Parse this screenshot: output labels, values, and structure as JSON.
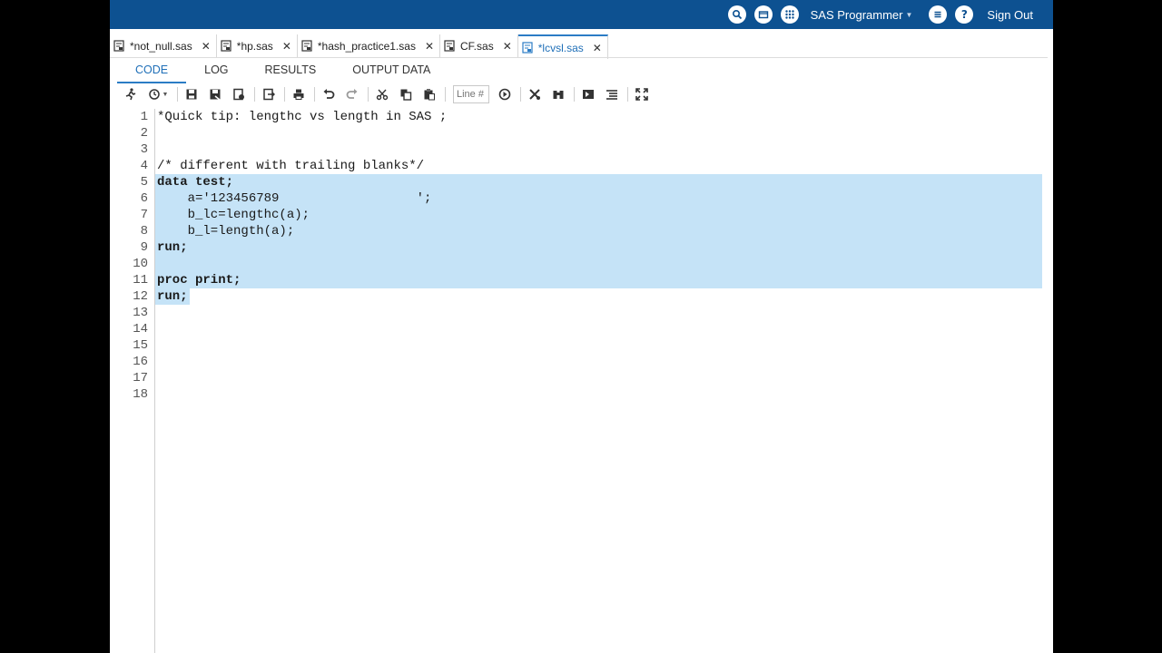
{
  "header": {
    "user": "SAS Programmer",
    "sign_out": "Sign Out",
    "icons": [
      "search-icon",
      "folder-icon",
      "apps-grid-icon",
      "menu-icon",
      "help-icon"
    ]
  },
  "file_tabs": [
    {
      "label": "*not_null.sas",
      "active": false
    },
    {
      "label": "*hp.sas",
      "active": false
    },
    {
      "label": "*hash_practice1.sas",
      "active": false
    },
    {
      "label": "CF.sas",
      "active": false
    },
    {
      "label": "*lcvsl.sas",
      "active": true
    }
  ],
  "sub_tabs": [
    {
      "label": "CODE",
      "active": true
    },
    {
      "label": "LOG",
      "active": false
    },
    {
      "label": "RESULTS",
      "active": false
    },
    {
      "label": "OUTPUT DATA",
      "active": false
    }
  ],
  "toolbar": {
    "line_placeholder": "Line #"
  },
  "code_lines": [
    {
      "n": "1",
      "text": "*Quick tip: lengthc vs length in SAS ;"
    },
    {
      "n": "2",
      "text": ""
    },
    {
      "n": "3",
      "text": ""
    },
    {
      "n": "4",
      "text": "/* different with trailing blanks*/"
    },
    {
      "n": "5",
      "text": "data test;"
    },
    {
      "n": "6",
      "text": "    a='123456789                  ';"
    },
    {
      "n": "7",
      "text": "    b_lc=lengthc(a);"
    },
    {
      "n": "8",
      "text": "    b_l=length(a);"
    },
    {
      "n": "9",
      "text": "run;"
    },
    {
      "n": "10",
      "text": ""
    },
    {
      "n": "11",
      "text": "proc print;"
    },
    {
      "n": "12",
      "text": "run;"
    },
    {
      "n": "13",
      "text": ""
    },
    {
      "n": "14",
      "text": ""
    },
    {
      "n": "15",
      "text": ""
    },
    {
      "n": "16",
      "text": ""
    },
    {
      "n": "17",
      "text": ""
    },
    {
      "n": "18",
      "text": ""
    }
  ]
}
